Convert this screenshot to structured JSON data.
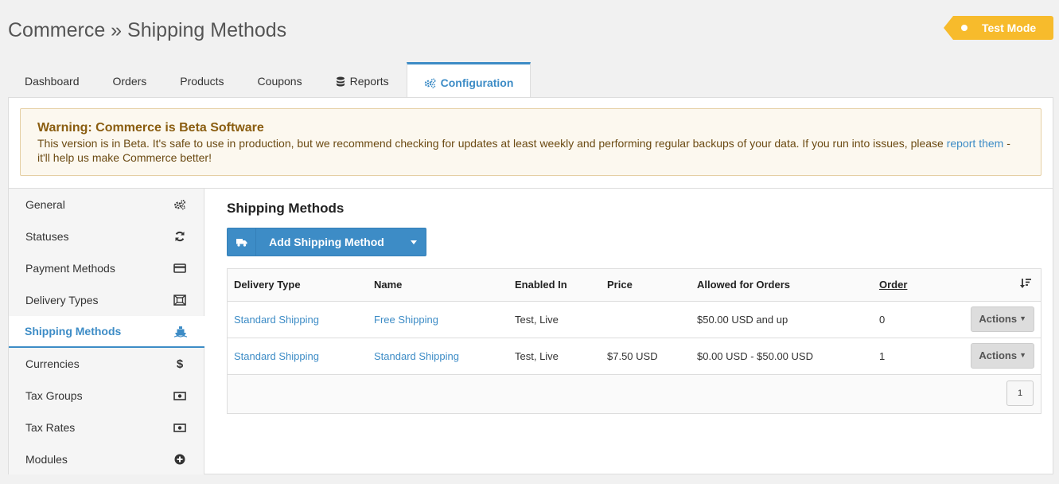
{
  "page": {
    "title": "Commerce » Shipping Methods"
  },
  "badge": {
    "label": "Test Mode",
    "color": "#f7bb2c"
  },
  "tabs": [
    {
      "label": "Dashboard"
    },
    {
      "label": "Orders"
    },
    {
      "label": "Products"
    },
    {
      "label": "Coupons"
    },
    {
      "label": "Reports",
      "icon": "database-icon"
    },
    {
      "label": "Configuration",
      "icon": "gears-icon",
      "active": true
    }
  ],
  "warning": {
    "title": "Warning: Commerce is Beta Software",
    "text_before": "This version is in Beta. It's safe to use in production, but we recommend checking for updates at least weekly and performing regular backups of your data. If you run into issues, please ",
    "link": "report them",
    "text_after": " - it'll help us make Commerce better!"
  },
  "sidebar": {
    "items": [
      {
        "label": "General",
        "icon": "gears-icon"
      },
      {
        "label": "Statuses",
        "icon": "refresh-icon"
      },
      {
        "label": "Payment Methods",
        "icon": "credit-card-icon"
      },
      {
        "label": "Delivery Types",
        "icon": "expand-box-icon"
      },
      {
        "label": "Shipping Methods",
        "icon": "ship-icon",
        "active": true
      },
      {
        "label": "Currencies",
        "icon": "dollar-icon"
      },
      {
        "label": "Tax Groups",
        "icon": "money-icon"
      },
      {
        "label": "Tax Rates",
        "icon": "money-icon"
      },
      {
        "label": "Modules",
        "icon": "plus-circle-icon"
      }
    ]
  },
  "main": {
    "heading": "Shipping Methods",
    "add_button": "Add Shipping Method",
    "table": {
      "headers": [
        "Delivery Type",
        "Name",
        "Enabled In",
        "Price",
        "Allowed for Orders",
        "Order"
      ],
      "rows": [
        {
          "delivery_type": "Standard Shipping",
          "name": "Free Shipping",
          "enabled_in": "Test, Live",
          "price": "",
          "allowed": "$50.00 USD and up",
          "order": "0",
          "actions": "Actions"
        },
        {
          "delivery_type": "Standard Shipping",
          "name": "Standard Shipping",
          "enabled_in": "Test, Live",
          "price": "$7.50 USD",
          "allowed": "$0.00 USD - $50.00 USD",
          "order": "1",
          "actions": "Actions"
        }
      ]
    },
    "pagination": {
      "page": "1"
    }
  },
  "colors": {
    "accent": "#3d8cc6",
    "warning_bg": "#fcf8ef"
  }
}
